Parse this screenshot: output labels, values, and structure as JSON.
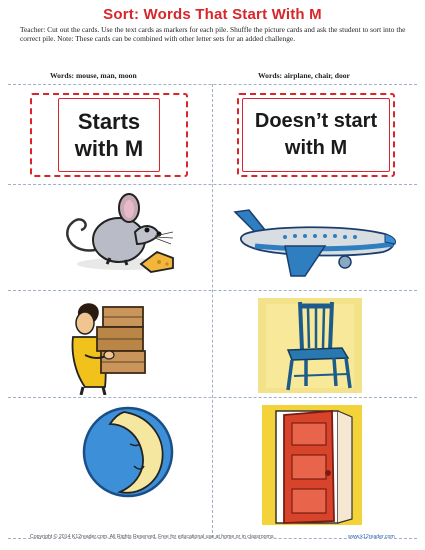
{
  "title": "Sort: Words That Start With M",
  "instructions": "Teacher: Cut out the cards. Use the text cards as markers for each pile. Shuffle the picture cards and ask the student to sort into the correct pile. Note: These cards can be combined with other letter sets for an added challenge.",
  "words_left": "Words: mouse, man, moon",
  "words_right": "Words: airplane, chair, door",
  "card_left": "Starts with M",
  "card_right": "Doesn’t start with M",
  "footer_left": "Copyright © 2014  K12reader.com. All Rights Reserved. Free for educational use at home or in classrooms.",
  "footer_right": "www.k12reader.com",
  "colors": {
    "title": "#d8262b",
    "card_border": "#d8262b",
    "cut_line": "#9fb0c7",
    "link": "#2b5fb0"
  },
  "pictures": [
    "mouse",
    "airplane",
    "man",
    "chair",
    "moon",
    "door"
  ]
}
